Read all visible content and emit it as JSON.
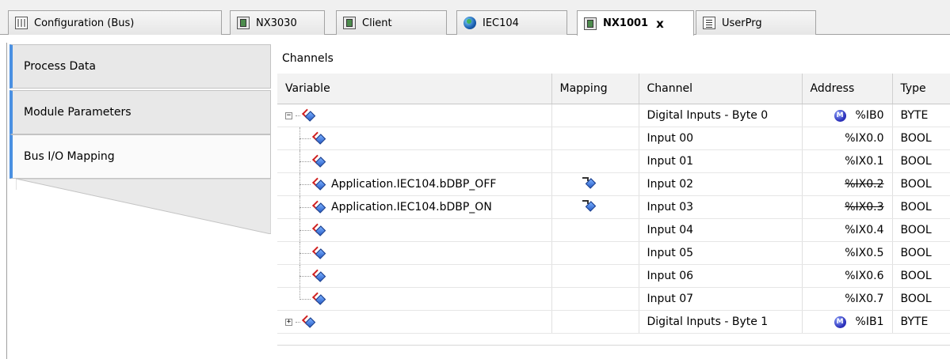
{
  "tabs": [
    {
      "label": "Configuration (Bus)",
      "icon": "bus-config-icon"
    },
    {
      "label": "NX3030",
      "icon": "device-icon"
    },
    {
      "label": "Client",
      "icon": "device-icon"
    },
    {
      "label": "IEC104",
      "icon": "globe-icon"
    },
    {
      "label": "NX1001",
      "icon": "device-icon",
      "active": true
    },
    {
      "label": "UserPrg",
      "icon": "document-icon"
    }
  ],
  "close_symbol": "x",
  "side_tabs": [
    "Process Data",
    "Module Parameters",
    "Bus I/O Mapping"
  ],
  "channels_title": "Channels",
  "columns": [
    "Variable",
    "Mapping",
    "Channel",
    "Address",
    "Type"
  ],
  "rows": [
    {
      "variable": "",
      "channel": "Digital Inputs - Byte 0",
      "address": "%IB0",
      "type": "BYTE",
      "badge": "M"
    },
    {
      "variable": "",
      "channel": "Input 00",
      "address": "%IX0.0",
      "type": "BOOL"
    },
    {
      "variable": "",
      "channel": "Input 01",
      "address": "%IX0.1",
      "type": "BOOL"
    },
    {
      "variable": "Application.IEC104.bDBP_OFF",
      "channel": "Input 02",
      "address": "%IX0.2",
      "type": "BOOL",
      "mapped": true
    },
    {
      "variable": "Application.IEC104.bDBP_ON",
      "channel": "Input 03",
      "address": "%IX0.3",
      "type": "BOOL",
      "mapped": true
    },
    {
      "variable": "",
      "channel": "Input 04",
      "address": "%IX0.4",
      "type": "BOOL"
    },
    {
      "variable": "",
      "channel": "Input 05",
      "address": "%IX0.5",
      "type": "BOOL"
    },
    {
      "variable": "",
      "channel": "Input 06",
      "address": "%IX0.6",
      "type": "BOOL"
    },
    {
      "variable": "",
      "channel": "Input 07",
      "address": "%IX0.7",
      "type": "BOOL"
    },
    {
      "variable": "",
      "channel": "Digital Inputs - Byte 1",
      "address": "%IB1",
      "type": "BYTE",
      "badge": "M"
    }
  ],
  "expand_symbols": {
    "expanded": "−",
    "collapsed": "+"
  },
  "colors": {
    "accent": "#4a90e2",
    "badge": "#2a2fb8",
    "mapping_red": "#d02020"
  }
}
